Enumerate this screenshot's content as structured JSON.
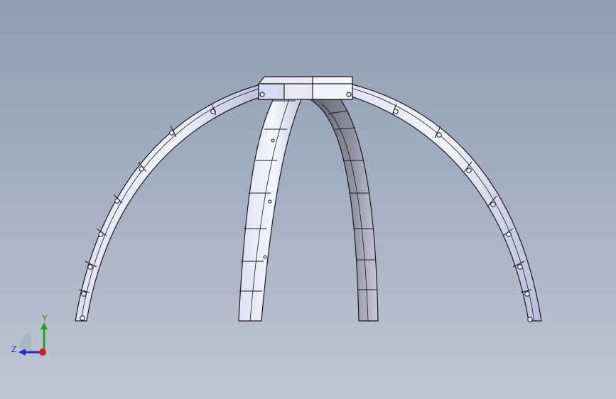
{
  "viewport": {
    "background_top": "#8f9db3",
    "background_bottom": "#c0c6d2"
  },
  "model": {
    "face_color": "#ececf6",
    "face_shade": "#b9bfdf",
    "edge_color": "#1a1a1a",
    "dark_face": "#7d7f8c",
    "arm_count": 4
  },
  "triad": {
    "y_label": "Y",
    "z_label": "Z",
    "y_color": "#1fa31f",
    "z_color": "#1f2ad1",
    "x_color": "#d11f1f"
  }
}
